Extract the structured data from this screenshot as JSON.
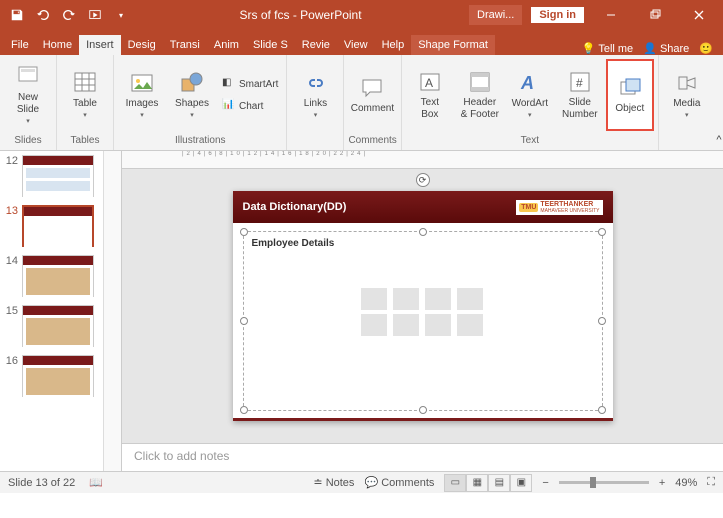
{
  "titlebar": {
    "title": "Srs of fcs  -  PowerPoint",
    "drawing": "Drawi...",
    "signin": "Sign in"
  },
  "tabs": {
    "file": "File",
    "home": "Home",
    "insert": "Insert",
    "design": "Desig",
    "transitions": "Transi",
    "animations": "Anim",
    "slideshow": "Slide S",
    "review": "Revie",
    "view": "View",
    "help": "Help",
    "shapeformat": "Shape Format",
    "tellme": "Tell me",
    "share": "Share"
  },
  "ribbon": {
    "slides": {
      "newslide": "New\nSlide",
      "label": "Slides"
    },
    "tables": {
      "table": "Table",
      "label": "Tables"
    },
    "illustrations": {
      "images": "Images",
      "shapes": "Shapes",
      "smartart": "SmartArt",
      "chart": "Chart",
      "label": "Illustrations"
    },
    "links": {
      "links": "Links"
    },
    "comments": {
      "comment": "Comment",
      "label": "Comments"
    },
    "text": {
      "textbox": "Text\nBox",
      "headerfooter": "Header\n& Footer",
      "wordart": "WordArt",
      "slidenumber": "Slide\nNumber",
      "object": "Object",
      "label": "Text"
    },
    "media": {
      "media": "Media"
    }
  },
  "thumbs": [
    {
      "n": "12"
    },
    {
      "n": "13",
      "sel": true
    },
    {
      "n": "14"
    },
    {
      "n": "15"
    },
    {
      "n": "16"
    }
  ],
  "slide": {
    "header": "Data Dictionary(DD)",
    "logo": "TEERTHANKER",
    "logo2": "MAHAVEER UNIVERSITY",
    "placeholder_title": "Employee Details"
  },
  "notes": {
    "placeholder": "Click to add notes"
  },
  "status": {
    "slide": "Slide 13 of 22",
    "notes": "Notes",
    "comments": "Comments",
    "zoom": "49%"
  }
}
